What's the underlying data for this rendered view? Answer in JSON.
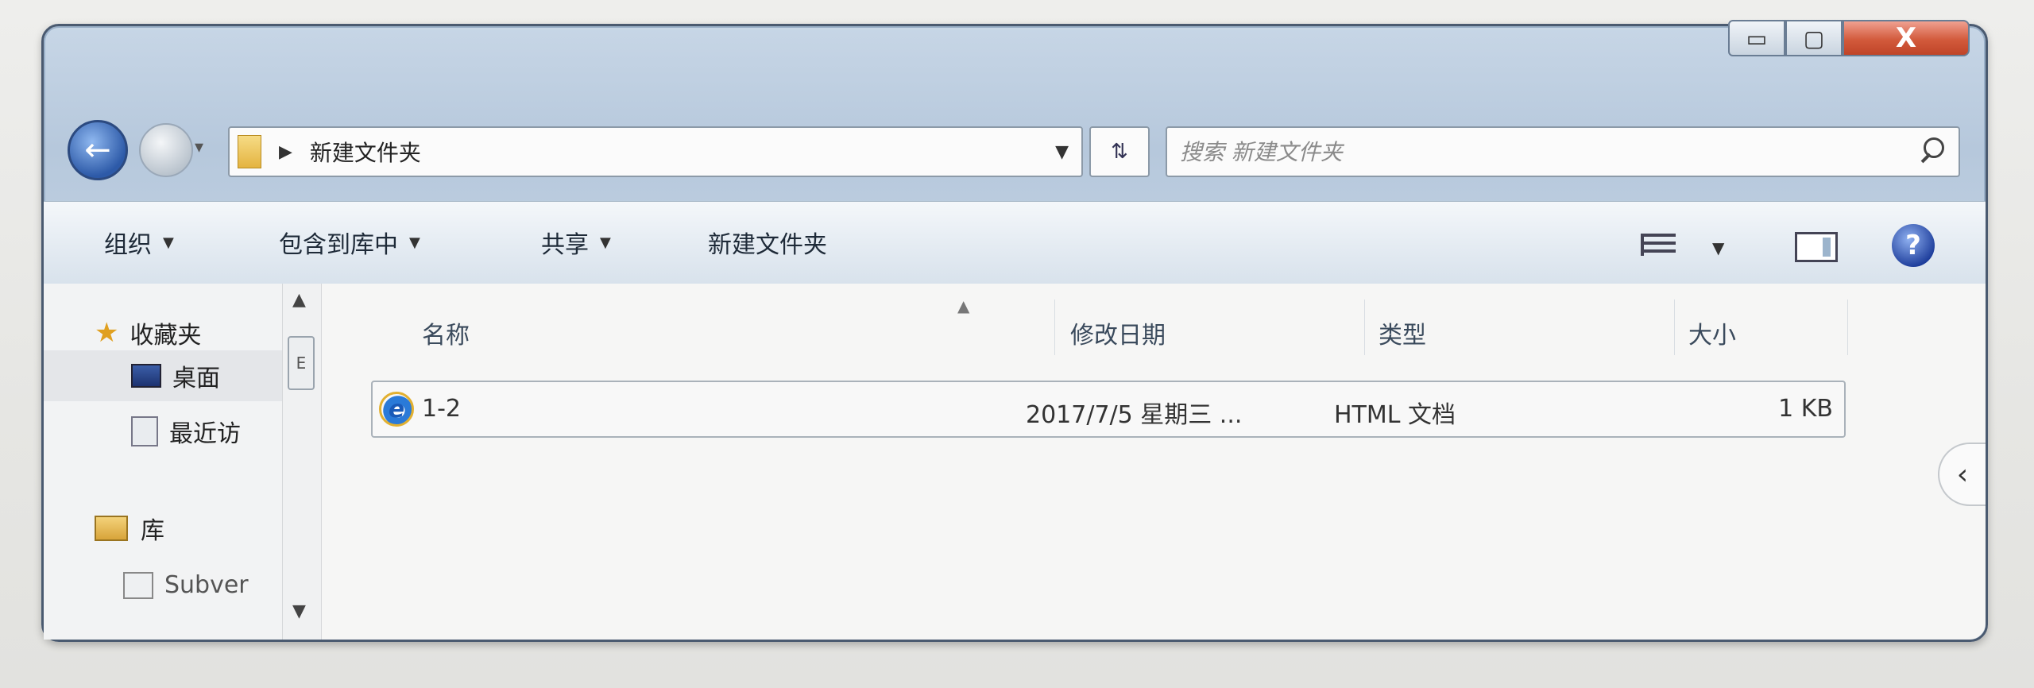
{
  "window": {
    "caption_buttons": {
      "minimize": "▭",
      "maximize": "▢",
      "close": "X"
    }
  },
  "nav": {
    "back_icon": "arrow-left-icon",
    "forward_icon": "arrow-right-icon",
    "address_path": "新建文件夹",
    "address_sep": "▶",
    "refresh_icon": "refresh-icon",
    "search_placeholder": "搜索 新建文件夹"
  },
  "toolbar": {
    "organize": "组织",
    "include_in_library": "包含到库中",
    "share": "共享",
    "new_folder": "新建文件夹"
  },
  "sidebar": {
    "items": [
      {
        "label": "收藏夹",
        "icon": "star-icon"
      },
      {
        "label": "桌面",
        "icon": "desktop-icon"
      },
      {
        "label": "最近访",
        "icon": "recent-icon"
      },
      {
        "label": "库",
        "icon": "library-icon"
      },
      {
        "label": "Subver",
        "icon": "user-folder-icon"
      }
    ],
    "scroll_thumb_label": "E"
  },
  "columns": {
    "name": "名称",
    "modified": "修改日期",
    "type": "类型",
    "size": "大小"
  },
  "files": [
    {
      "name": "1-2",
      "modified": "2017/7/5 星期三 ...",
      "type": "HTML 文档",
      "size": "1 KB",
      "icon": "ie-html-icon"
    }
  ],
  "colors": {
    "frame": "#4a5a70",
    "close_button": "#d25a3c",
    "toolbar": "#e4ebf2"
  }
}
